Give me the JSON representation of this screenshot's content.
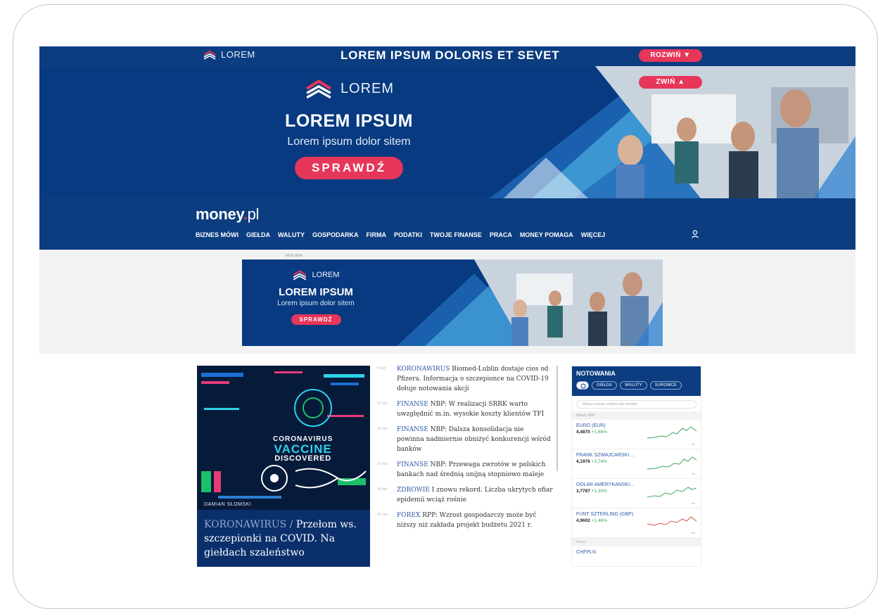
{
  "top_banner": {
    "logo_text": "LOREM",
    "title": "LOREM IPSUM  DOLORIS ET SEVET",
    "expand_label": "ROZWIŃ ▼",
    "collapse_label": "ZWIŃ  ▲"
  },
  "hero": {
    "logo_text": "LOREM",
    "title": "LOREM IPSUM",
    "subtitle": "Lorem ipsum dolor sitem",
    "cta": "SPRAWDŹ"
  },
  "site": {
    "brand_main": "money",
    "brand_dot": ".",
    "brand_tld": "pl",
    "nav": [
      "BIZNES MÓWI",
      "GIEŁDA",
      "WALUTY",
      "GOSPODARKA",
      "FIRMA",
      "PODATKI",
      "TWOJE FINANSE",
      "PRACA",
      "MONEY POMAGA",
      "WIĘCEJ"
    ]
  },
  "ad2": {
    "label": "REKLAMA",
    "logo_text": "LOREM",
    "title": "LOREM IPSUM",
    "subtitle": "Lorem ipsum dolor sitem",
    "cta": "SPRAWDŹ"
  },
  "feature": {
    "art_lines": [
      "CORONAVIRUS",
      "VACCINE",
      "DISCOVERED"
    ],
    "author": "DAMIAN SŁOMSKI",
    "category": "KORONAWIRUS / ",
    "title": "Przełom ws. szczepionki na COVID. Na giełdach szaleństwo"
  },
  "news": [
    {
      "time": "6 min",
      "category": "KORONAWIRUS",
      "text": "Biomed-Lublin dostaje cios od Pfizera. Informacja o szczepionce na COVID-19 dołuje notowania akcji"
    },
    {
      "time": "10 min",
      "category": "FINANSE",
      "text": "NBP: W realizacji SRRK warto uwzględnić m.in. wysokie koszty klientów TFI"
    },
    {
      "time": "18 min",
      "category": "FINANSE",
      "text": "NBP: Dalsza konsolidacja nie powinna nadmiernie obniżyć konkurencji wśród banków"
    },
    {
      "time": "23 min",
      "category": "FINANSE",
      "text": "NBP: Przewaga zwrotów w polskich bankach nad średnią unijną stopniowo maleje"
    },
    {
      "time": "36 min",
      "category": "ZDROWIE",
      "text": "I znowu rekord. Liczba ukrytych ofiar epidemii wciąż rośnie"
    },
    {
      "time": "43 min",
      "category": "FOREX",
      "text": "RPP: Wzrost gospodarczy może być niższy niż zakłada projekt budżetu 2021 r."
    }
  ],
  "quotes": {
    "title": "NOTOWANIA",
    "tabs": [
      "GIEŁDA",
      "WALUTY",
      "SUROWCE"
    ],
    "search_placeholder": "Wpisz nazwę waloru lub symbol",
    "section_nbp": "Waluty NBP",
    "section_forex": "Forex",
    "rows": [
      {
        "name": "EURO (EUR)",
        "value": "4,4870",
        "change": "+1,66%",
        "time": "3m"
      },
      {
        "name": "FRANK SZWAJCARSKI ...",
        "value": "4,1976",
        "change": "+2,74%",
        "time": "3m"
      },
      {
        "name": "DOLAR AMERYKAŃSKI...",
        "value": "3,7787",
        "change": "+1,30%",
        "time": "3m"
      },
      {
        "name": "FUNT SZTERLING (GBP)",
        "value": "4,9602",
        "change": "+1,48%",
        "time": "3m"
      }
    ],
    "forex_first": "CHFPLN"
  }
}
